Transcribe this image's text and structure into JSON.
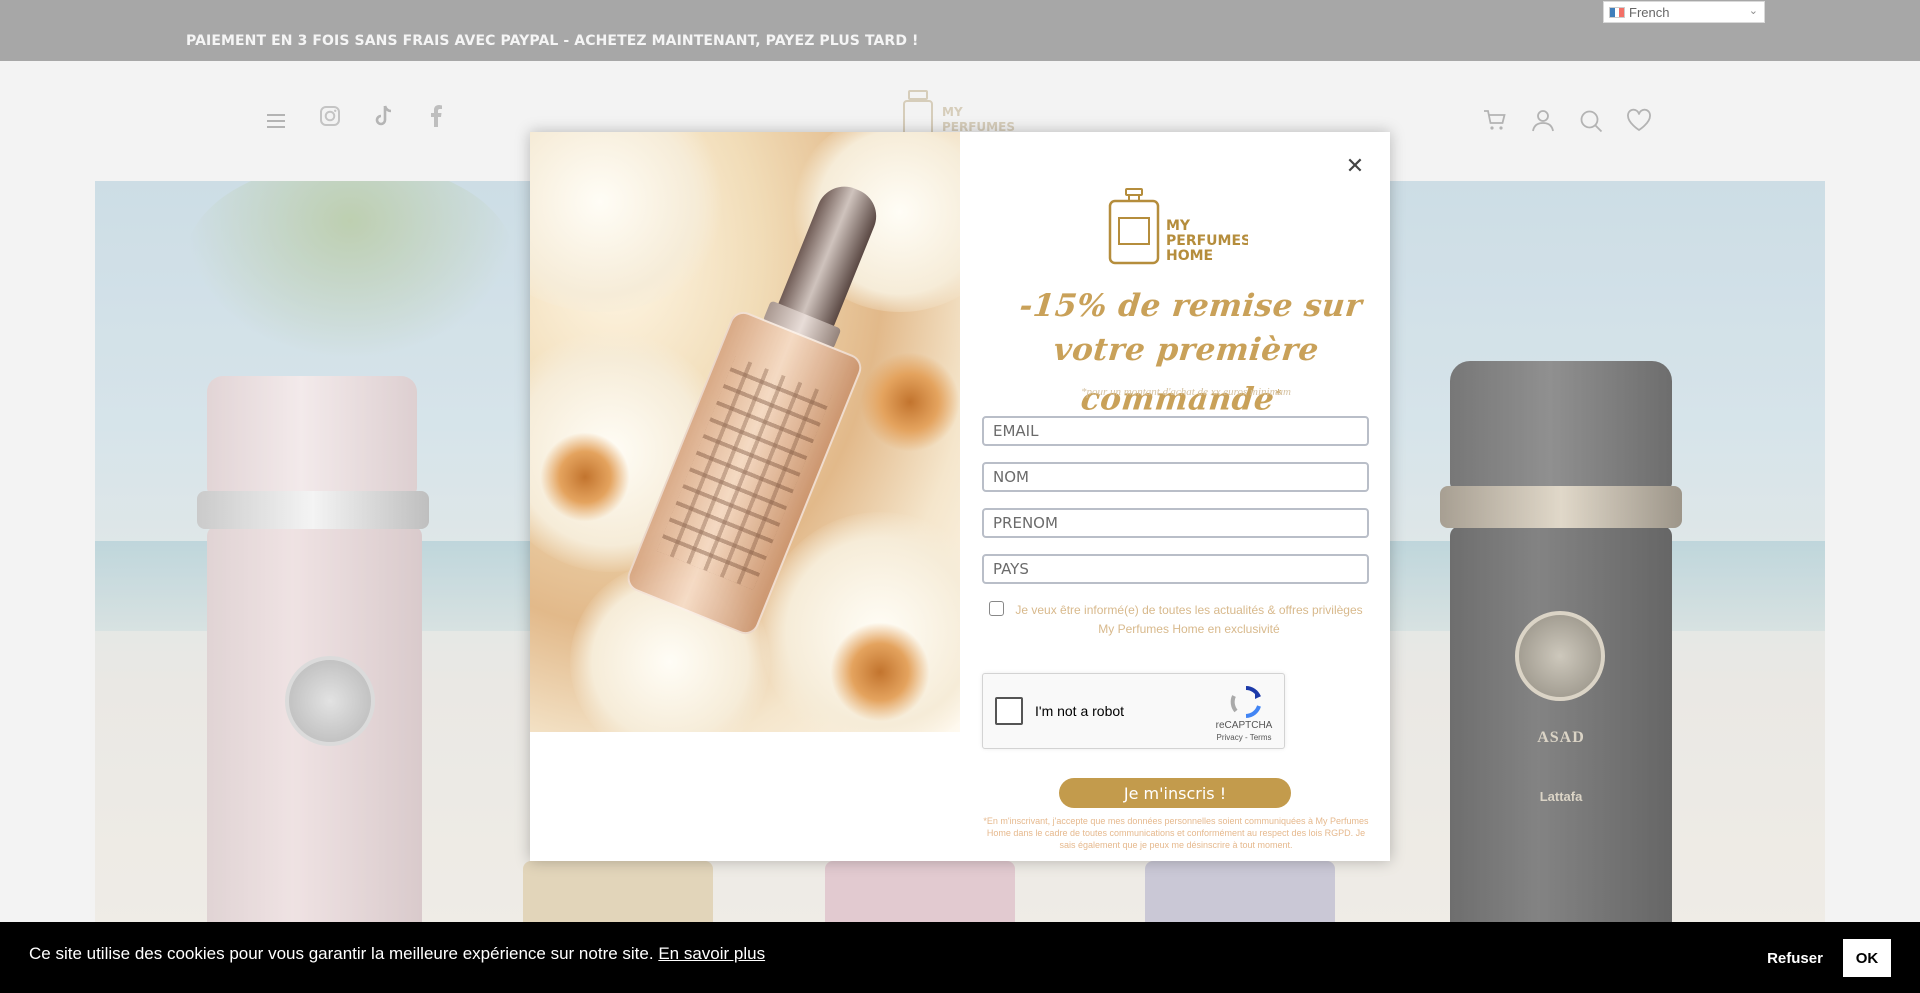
{
  "topbar": {
    "promo": "PAIEMENT EN 3 FOIS SANS FRAIS AVEC PAYPAL - ACHETEZ MAINTENANT, PAYEZ PLUS TARD !",
    "language": "French"
  },
  "header": {
    "logo_lines": [
      "MY",
      "PERFUMES"
    ]
  },
  "hero": {
    "right_bottle_name": "ASAD",
    "right_bottle_brand": "Lattafa"
  },
  "popup": {
    "logo_lines": [
      "MY",
      "PERFUMES",
      "HOME"
    ],
    "headline_line1": "-15% de remise sur",
    "headline_line2": "votre première commande",
    "headline_mark": "*",
    "subnote": "*pour un montant d'achat de xx euros minimum",
    "fields": {
      "email_placeholder": "EMAIL",
      "nom_placeholder": "NOM",
      "prenom_placeholder": "PRENOM",
      "pays_placeholder": "PAYS"
    },
    "consent_line1": "Je veux être informé(e) de toutes les actualités & offres privilèges",
    "consent_line2": "My Perfumes Home en exclusivité",
    "captcha": {
      "label": "I'm not a robot",
      "brand": "reCAPTCHA",
      "links": "Privacy - Terms"
    },
    "submit_label": "Je m'inscris !",
    "legal": "*En m'inscrivant, j'accepte que mes données personnelles soient communiquées à My Perfumes Home dans le cadre de toutes communications et conformément au respect des lois RGPD. Je sais également que je peux me désinscrire à tout moment."
  },
  "cookie_bar": {
    "message": "Ce site utilise des cookies pour vous garantir la meilleure expérience sur notre site.",
    "link": "En savoir plus",
    "refuse_label": "Refuser",
    "ok_label": "OK"
  },
  "colors": {
    "gold": "#c39b4c",
    "topbar": "#8a8a8a",
    "cookie_bg": "#000000"
  }
}
